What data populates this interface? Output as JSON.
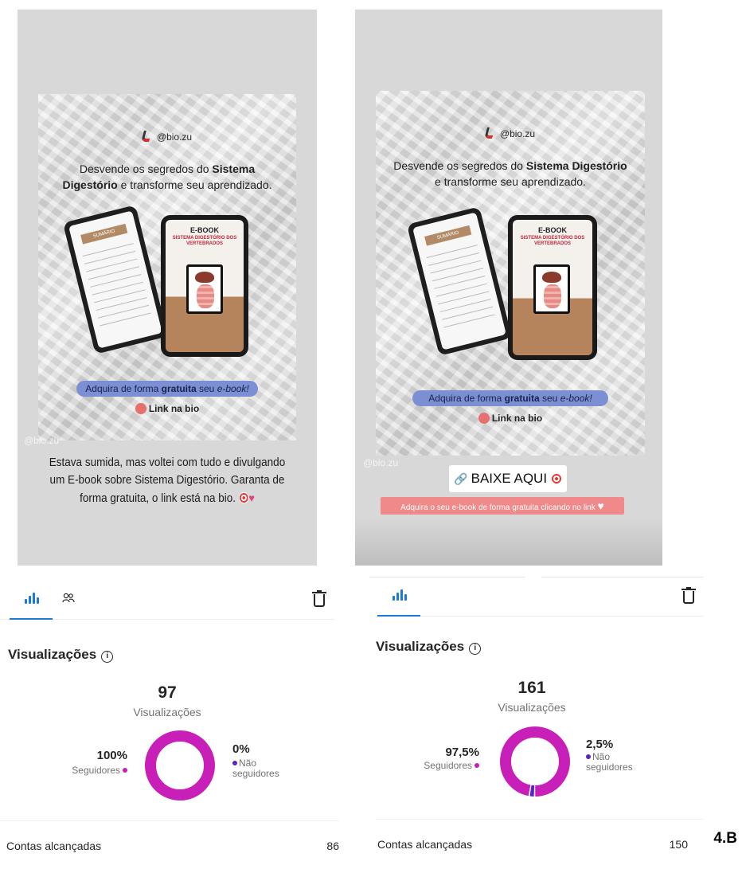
{
  "figure_label": "4.B",
  "left": {
    "poster": {
      "handle": "@bio.zu",
      "headline_pre": "Desvende os segredos do ",
      "headline_bold": "Sistema Digestório",
      "headline_post": " e transforme seu aprendizado.",
      "ebook_title": "E-BOOK",
      "ebook_subtitle": "SISTEMA DIGESTÓRIO DOS VERTEBRADOS",
      "summary_title": "SUMÁRIO",
      "cta_pre": "Adquira de forma ",
      "cta_bold": "gratuita",
      "cta_mid": " seu ",
      "cta_italic": "e-book!",
      "link_label": "Link na bio"
    },
    "watermark": "@bio.zu",
    "caption": "Estava sumida, mas voltei com tudo e divulgando um E-book sobre Sistema Digestório. Garanta de forma gratuita, o link está na bio.",
    "stats": {
      "section_title": "Visualizações",
      "total": "97",
      "total_label": "Visualizações",
      "followers_pct": "100%",
      "followers_label": "Seguidores",
      "non_followers_pct": "0%",
      "non_followers_label_1": "Não",
      "non_followers_label_2": "seguidores",
      "reach_label": "Contas alcançadas",
      "reach_value": "86"
    }
  },
  "right": {
    "poster": {
      "handle": "@bio.zu",
      "headline_pre": "Desvende os segredos do ",
      "headline_bold": "Sistema Digestório",
      "headline_post": " e transforme seu aprendizado.",
      "ebook_title": "E-BOOK",
      "ebook_subtitle": "SISTEMA DIGESTÓRIO DOS VERTEBRADOS",
      "summary_title": "SUMÁRIO",
      "cta_pre": "Adquira de forma ",
      "cta_bold": "gratuita",
      "cta_mid": " seu ",
      "cta_italic": "e-book!",
      "link_label": "Link na bio"
    },
    "watermark": "@bio.zu",
    "sticker_label": "BAIXE AQUI",
    "pink_bar": "Adquira o seu e-book de forma gratuita clicando no link",
    "stats": {
      "section_title": "Visualizações",
      "total": "161",
      "total_label": "Visualizações",
      "followers_pct": "97,5%",
      "followers_label": "Seguidores",
      "non_followers_pct": "2,5%",
      "non_followers_label_1": "Não",
      "non_followers_label_2": "seguidores",
      "reach_label": "Contas alcançadas",
      "reach_value": "150"
    }
  },
  "colors": {
    "followers": "#c81fb8",
    "non_followers": "#5b22c9",
    "accent": "#1a7bd6"
  },
  "chart_data": [
    {
      "type": "pie",
      "categories": [
        "Seguidores",
        "Não seguidores"
      ],
      "values": [
        100,
        0
      ]
    },
    {
      "type": "pie",
      "categories": [
        "Seguidores",
        "Não seguidores"
      ],
      "values": [
        97.5,
        2.5
      ]
    }
  ]
}
